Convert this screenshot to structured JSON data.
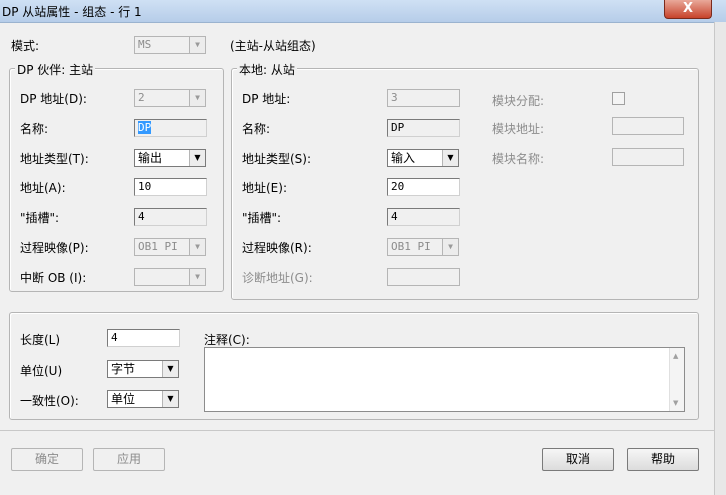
{
  "window": {
    "title": "DP 从站属性 - 组态 - 行 1",
    "close_label": "X"
  },
  "mode": {
    "label": "模式:",
    "value": "MS",
    "description": "(主站-从站组态)"
  },
  "dp_partner": {
    "title": "DP 伙伴: 主站",
    "address_label": "DP 地址(D):",
    "address_value": "2",
    "name_label": "名称:",
    "name_value": "DP",
    "address_type_label": "地址类型(T):",
    "address_type_value": "输出",
    "address_label2": "地址(A):",
    "address_value2": "10",
    "slot_label": "\"插槽\":",
    "slot_value": "4",
    "process_image_label": "过程映像(P):",
    "process_image_value": "OB1 PI",
    "interrupt_ob_label": "中断 OB (I):",
    "interrupt_ob_value": ""
  },
  "local": {
    "title": "本地: 从站",
    "dp_address_label": "DP 地址:",
    "dp_address_value": "3",
    "name_label": "名称:",
    "name_value": "DP",
    "address_type_label": "地址类型(S):",
    "address_type_value": "输入",
    "address_label": "地址(E):",
    "address_value": "20",
    "slot_label": "\"插槽\":",
    "slot_value": "4",
    "process_image_label": "过程映像(R):",
    "process_image_value": "OB1 PI",
    "diag_address_label": "诊断地址(G):",
    "diag_address_value": "",
    "module_assign_label": "模块分配:",
    "module_assign_checked": false,
    "module_address_label": "模块地址:",
    "module_address_value": "",
    "module_name_label": "模块名称:",
    "module_name_value": ""
  },
  "bottom": {
    "length_label": "长度(L)",
    "length_value": "4",
    "unit_label": "单位(U)",
    "unit_value": "字节",
    "consistency_label": "一致性(O):",
    "consistency_value": "单位",
    "comment_label": "注释(C):",
    "comment_value": ""
  },
  "buttons": {
    "ok": "确定",
    "apply": "应用",
    "cancel": "取消",
    "help": "帮助"
  }
}
